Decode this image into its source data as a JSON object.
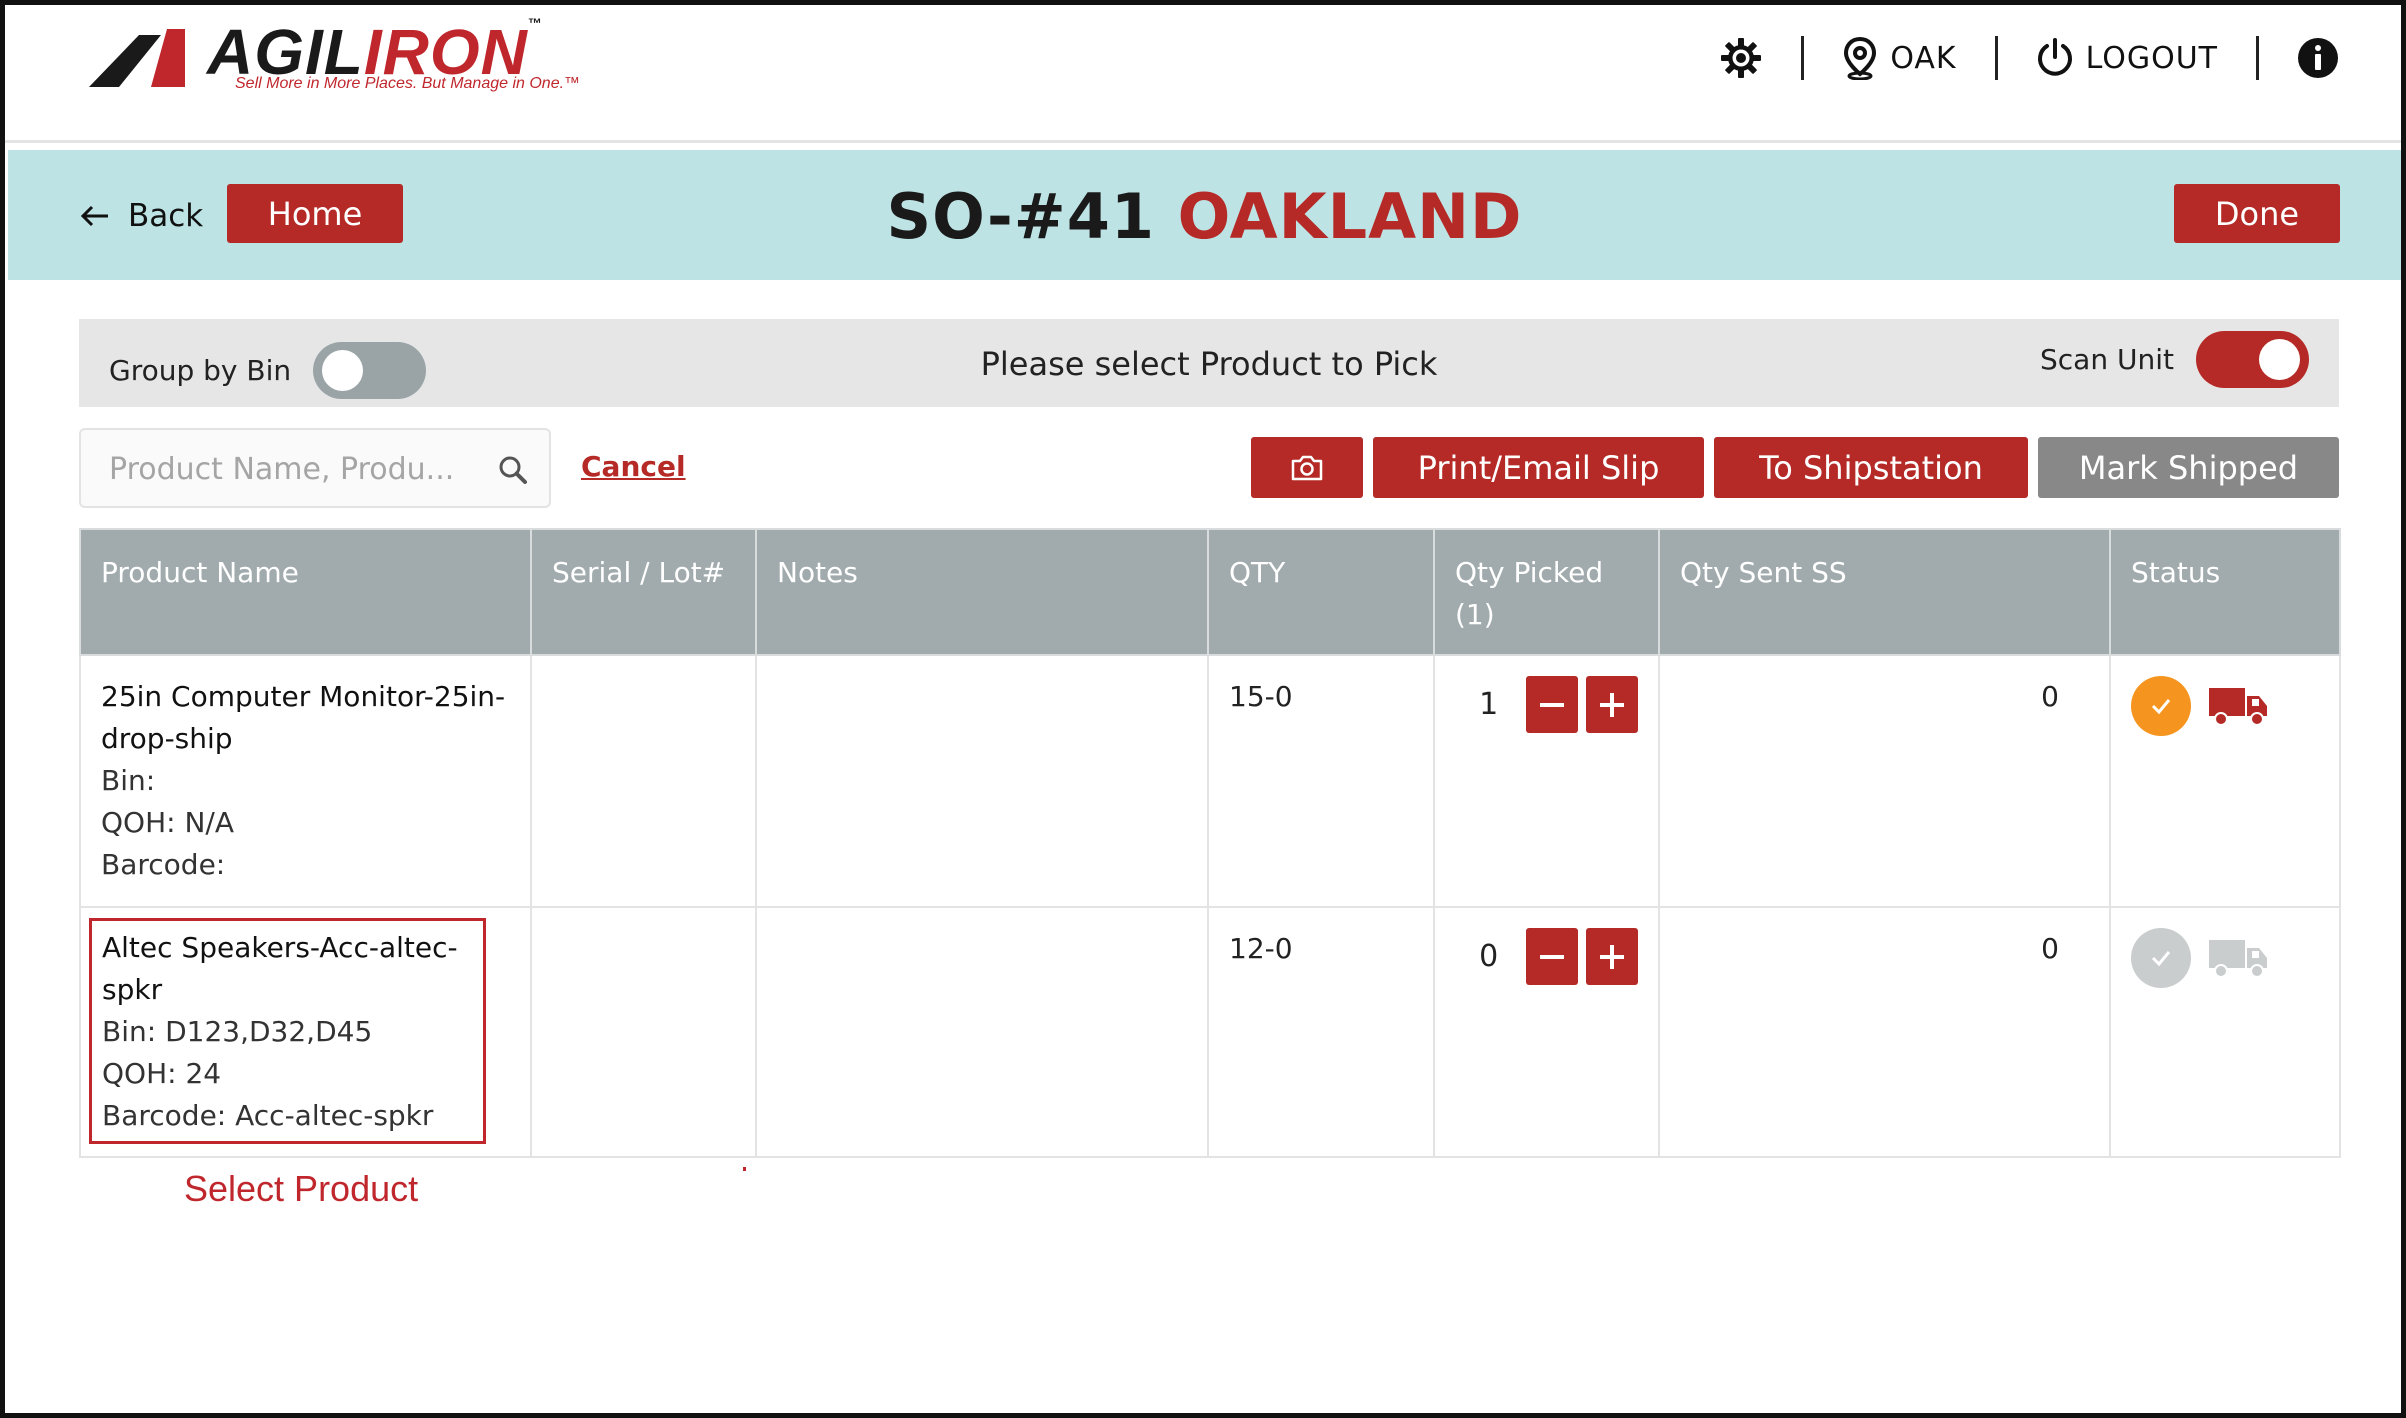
{
  "brand": {
    "name_black": "AGIL",
    "name_red": "IRON",
    "tm": "™",
    "tagline": "Sell More in More Places. But Manage in One.™"
  },
  "topbar": {
    "location_label": "OAK",
    "logout_label": "LOGOUT",
    "icons": [
      "gear-icon",
      "location-pin-icon",
      "power-icon",
      "info-icon"
    ]
  },
  "header": {
    "back_label": "Back",
    "home_label": "Home",
    "title_order": "SO-#41",
    "title_location": "OAKLAND",
    "done_label": "Done"
  },
  "controls": {
    "group_by_bin_label": "Group by Bin",
    "group_by_bin_on": false,
    "instruction": "Please select Product to Pick",
    "scan_unit_label": "Scan Unit",
    "scan_unit_on": true
  },
  "search": {
    "placeholder": "Product Name, Produ...",
    "cancel_label": "Cancel"
  },
  "actions": {
    "print_label": "Print/Email Slip",
    "shipstation_label": "To Shipstation",
    "mark_shipped_label": "Mark Shipped"
  },
  "table": {
    "columns": {
      "product": "Product Name",
      "serial": "Serial / Lot#",
      "notes": "Notes",
      "qty": "QTY",
      "qty_picked_line1": "Qty Picked",
      "qty_picked_line2": "(1)",
      "qty_sent": "Qty Sent SS",
      "status": "Status"
    },
    "rows": [
      {
        "name": "25in Computer Monitor-25in-drop-ship",
        "bin": "Bin:",
        "qoh": "QOH: N/A",
        "barcode": "Barcode:",
        "serial": "",
        "notes": "",
        "qty": "15-0",
        "qty_picked": "1",
        "qty_sent": "0",
        "status": "picked"
      },
      {
        "name": "Altec Speakers-Acc-altec-spkr",
        "bin": "Bin: D123,D32,D45",
        "qoh": "QOH: 24",
        "barcode": "Barcode: Acc-altec-spkr",
        "serial": "",
        "notes": "",
        "qty": "12-0",
        "qty_picked": "0",
        "qty_sent": "0",
        "status": "pending"
      }
    ]
  },
  "annotation": {
    "select_product": "Select Product"
  },
  "colors": {
    "brand_red": "#b52a26",
    "band_blue": "#bde3e5",
    "header_grey": "#a1abad",
    "status_orange": "#f5951f",
    "status_grey": "#c9cdce"
  }
}
